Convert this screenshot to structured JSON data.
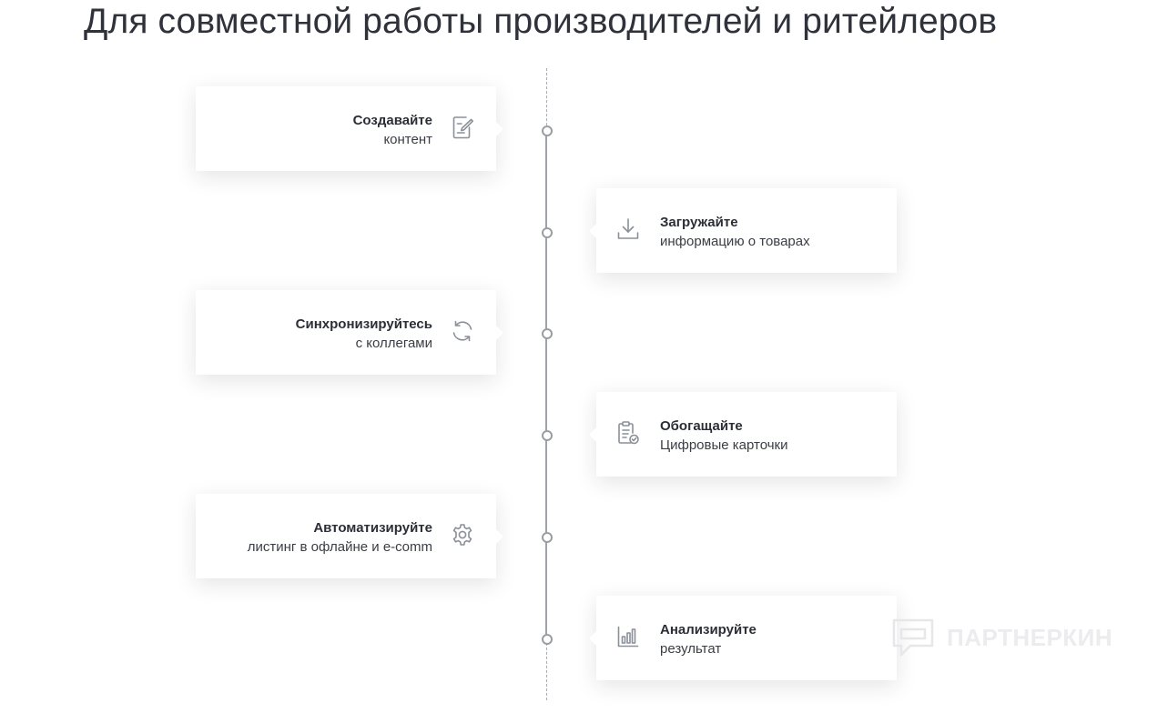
{
  "title": "Для совместной работы производителей и ритейлеров",
  "steps": [
    {
      "side": "left",
      "title": "Создавайте",
      "subtitle": "контент",
      "icon": "edit-document-icon"
    },
    {
      "side": "right",
      "title": "Загружайте",
      "subtitle": "информацию о товарах",
      "icon": "download-icon"
    },
    {
      "side": "left",
      "title": "Синхронизируйтесь",
      "subtitle": "с коллегами",
      "icon": "sync-icon"
    },
    {
      "side": "right",
      "title": "Обогащайте",
      "subtitle": "Цифровые карточки",
      "icon": "clipboard-check-icon"
    },
    {
      "side": "left",
      "title": "Автоматизируйте",
      "subtitle": "листинг в офлайне и e-comm",
      "icon": "gear-icon"
    },
    {
      "side": "right",
      "title": "Анализируйте",
      "subtitle": "результат",
      "icon": "bar-chart-icon"
    }
  ],
  "watermark": {
    "text": "ПАРТНЕРКИН",
    "icon": "chat-bubble-icon"
  },
  "colors": {
    "text": "#2c2f36",
    "icon": "#8a8f98",
    "timeline": "#9fa3a9",
    "watermark": "#ececee"
  }
}
